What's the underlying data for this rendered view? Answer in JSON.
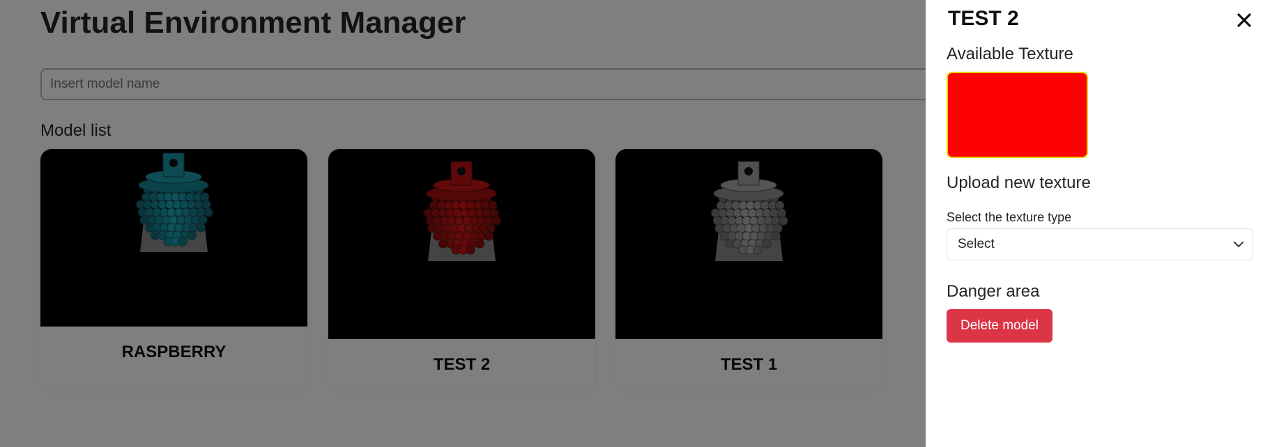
{
  "main": {
    "title": "Virtual Environment Manager",
    "search": {
      "placeholder": "Insert model name",
      "value": ""
    },
    "model_list_heading": "Model list",
    "models": [
      {
        "name": "RASPBERRY",
        "color": "#1b9aac"
      },
      {
        "name": "TEST 2",
        "color": "#c41414"
      },
      {
        "name": "TEST 1",
        "color": "#a8a8a8"
      }
    ]
  },
  "panel": {
    "title": "TEST 2",
    "close_icon": "close-icon",
    "available_texture_heading": "Available Texture",
    "texture_swatch_color": "#ff0000",
    "upload_heading": "Upload new texture",
    "texture_type_label": "Select the texture type",
    "texture_type_selected": "Select",
    "danger_heading": "Danger area",
    "delete_label": "Delete model",
    "delete_color": "#dc3545"
  }
}
